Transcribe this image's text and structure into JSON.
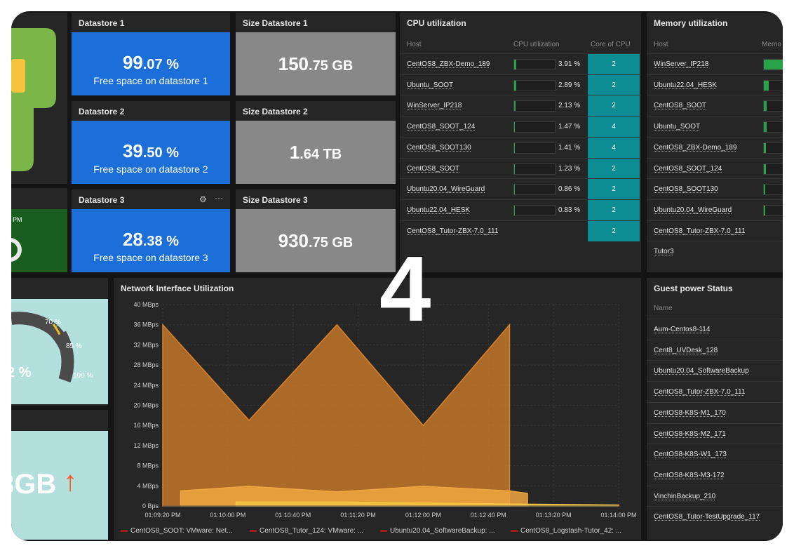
{
  "datastores": [
    {
      "title": "Datastore 1",
      "value_int": "99",
      "value_dec": ".07 %",
      "caption": "Free space on datastore 1"
    },
    {
      "title": "Datastore 2",
      "value_int": "39",
      "value_dec": ".50 %",
      "caption": "Free space on datastore 2"
    },
    {
      "title": "Datastore 3",
      "value_int": "28",
      "value_dec": ".38 %",
      "caption": "Free space on datastore 3"
    }
  ],
  "sizes": [
    {
      "title": "Size Datastore 1",
      "value_int": "150",
      "value_dec": ".75 GB"
    },
    {
      "title": "Size Datastore 2",
      "value_int": "1",
      "value_dec": ".64 TB"
    },
    {
      "title": "Size Datastore 3",
      "value_int": "930",
      "value_dec": ".75 GB"
    }
  ],
  "cpu": {
    "title": "CPU utilization",
    "headers": [
      "Host",
      "CPU utilization",
      "Core of CPU"
    ],
    "rows": [
      {
        "host": "CentOS8_ZBX-Demo_189",
        "pct": "3.91 %",
        "value": 3.91,
        "core": "2"
      },
      {
        "host": "Ubuntu_SOOT",
        "pct": "2.89 %",
        "value": 2.89,
        "core": "2"
      },
      {
        "host": "WinServer_IP218",
        "pct": "2.13 %",
        "value": 2.13,
        "core": "2"
      },
      {
        "host": "CentOS8_SOOT_124",
        "pct": "1.47 %",
        "value": 1.47,
        "core": "4"
      },
      {
        "host": "CentOS8_SOOT130",
        "pct": "1.41 %",
        "value": 1.41,
        "core": "4"
      },
      {
        "host": "CentOS8_SOOT",
        "pct": "1.23 %",
        "value": 1.23,
        "core": "2"
      },
      {
        "host": "Ubuntu20.04_WireGuard",
        "pct": "0.86 %",
        "value": 0.86,
        "core": "2"
      },
      {
        "host": "Ubuntu22.04_HESK",
        "pct": "0.83 %",
        "value": 0.83,
        "core": "2"
      },
      {
        "host": "CentOS8_Tutor-ZBX-7.0_111",
        "pct": "",
        "value": null,
        "core": "2"
      }
    ]
  },
  "memory": {
    "title": "Memory utilization",
    "headers": [
      "Host",
      "Memo"
    ],
    "rows": [
      {
        "host": "WinServer_IP218",
        "value": 70
      },
      {
        "host": "Ubuntu22.04_HESK",
        "value": 18
      },
      {
        "host": "CentOS8_SOOT",
        "value": 10
      },
      {
        "host": "Ubuntu_SOOT",
        "value": 10
      },
      {
        "host": "CentOS8_ZBX-Demo_189",
        "value": 8
      },
      {
        "host": "CentOS8_SOOT_124",
        "value": 8
      },
      {
        "host": "CentOS8_SOOT130",
        "value": 6
      },
      {
        "host": "Ubuntu20.04_WireGuard",
        "value": 6
      },
      {
        "host": "CentOS8_Tutor-ZBX-7.0_111",
        "value": null
      },
      {
        "host": "Tutor3",
        "value": null
      }
    ]
  },
  "left_panels": {
    "tile_pm": "PM",
    "gauge_ticks": [
      "70 %",
      "85 %",
      "100 %"
    ],
    "gauge_value": "2 %",
    "size_value": "3GB",
    "up_arrow": "↑"
  },
  "network": {
    "title": "Network Interface Utilization",
    "legend": [
      "CentOS8_SOOT: VMware: Net...",
      "CentOS8_Tutor_124: VMware: ...",
      "Ubuntu20.04_SoftwareBackup: ...",
      "CentOS8_Logstash-Tutor_42: ..."
    ]
  },
  "chart_data": {
    "type": "area",
    "title": "Network Interface Utilization",
    "y_unit": "MBps",
    "ylim": [
      0,
      40
    ],
    "y_ticks": [
      "0 Bps",
      "4 MBps",
      "8 MBps",
      "12 MBps",
      "16 MBps",
      "20 MBps",
      "24 MBps",
      "28 MBps",
      "32 MBps",
      "36 MBps",
      "40 MBps"
    ],
    "x_ticks": [
      "01:09:20 PM",
      "01:10:00 PM",
      "01:10:40 PM",
      "01:11:20 PM",
      "01:12:00 PM",
      "01:12:40 PM",
      "01:13:20 PM",
      "01:14:00 PM"
    ],
    "x_range_seconds": [
      0,
      280
    ],
    "grid": true,
    "series": [
      {
        "name": "CentOS8_SOOT: VMware: Net...",
        "color": "#d9822b",
        "points": [
          [
            0,
            36
          ],
          [
            53,
            17
          ],
          [
            107,
            36
          ],
          [
            160,
            16
          ],
          [
            213,
            36
          ],
          [
            213,
            0
          ]
        ]
      },
      {
        "name": "CentOS8_Tutor_124: VMware: ...",
        "color": "#f0a640",
        "points": [
          [
            11,
            3
          ],
          [
            53,
            3.9
          ],
          [
            107,
            2.8
          ],
          [
            160,
            3.9
          ],
          [
            213,
            3.0
          ],
          [
            224,
            2.5
          ],
          [
            224,
            0
          ]
        ]
      },
      {
        "name": "Ubuntu20.04_SoftwareBackup: ...",
        "color": "#f5c542",
        "points": [
          [
            45,
            0.8
          ],
          [
            107,
            0.8
          ],
          [
            160,
            0.6
          ],
          [
            213,
            0.4
          ],
          [
            280,
            0.2
          ]
        ]
      }
    ]
  },
  "guest_power": {
    "title": "Guest power Status",
    "header": "Name",
    "rows": [
      "Aum-Centos8-114",
      "Cent8_UVDesk_128",
      "Ubuntu20.04_SoftwareBackup",
      "CentOS8_Tutor-ZBX-7.0_111",
      "CentOS8-K8S-M1_170",
      "CentOS8-K8S-M2_171",
      "CentOS8-K8S-W1_173",
      "CentOS8-K8S-M3-172",
      "VinchinBackup_210",
      "CentOS8_Tutor-TestUpgrade_117"
    ]
  },
  "overlay_number": "4",
  "colors": {
    "blue_tile": "#1c6fd8",
    "grey_tile": "#888888",
    "core_teal": "#0e8c94",
    "green_tile": "#1a5e1f",
    "aqua_tile": "#b3e0dc",
    "arrow": "#ff5a1f"
  }
}
